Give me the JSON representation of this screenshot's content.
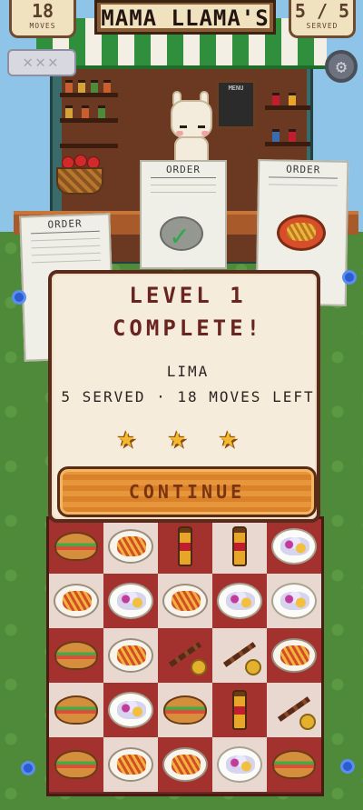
{
  "hud": {
    "moves_value": "18",
    "moves_label": "MOVES",
    "title": "MAMA LLAMA'S",
    "served_value": "5 / 5",
    "served_label": "SERVED",
    "strikes": "✕✕✕",
    "settings_icon": "gear-icon"
  },
  "stall": {
    "menu_board_label": "MENU",
    "orders": [
      {
        "label": "ORDER",
        "item": "sandwich-icon",
        "status": ""
      },
      {
        "label": "ORDER",
        "item": "burger-icon",
        "status": "completed"
      },
      {
        "label": "ORDER",
        "item": "fries-icon",
        "status": ""
      }
    ]
  },
  "modal": {
    "title_line1": "LEVEL 1",
    "title_line2": "COMPLETE!",
    "city": "LIMA",
    "stats": "5 SERVED · 18 MOVES LEFT",
    "stars_earned": 3,
    "stars_total": 3,
    "continue_label": "CONTINUE"
  },
  "board": {
    "rows": 5,
    "cols": 5,
    "tiles": [
      [
        "burger",
        "fries",
        "soda",
        "soda",
        "ceviche"
      ],
      [
        "fries",
        "ceviche",
        "fries",
        "ceviche",
        "ceviche"
      ],
      [
        "burger",
        "fries",
        "skewer",
        "skewer",
        "fries"
      ],
      [
        "burger",
        "ceviche",
        "burger",
        "soda",
        "skewer"
      ],
      [
        "burger",
        "fries",
        "fries",
        "ceviche",
        "burger"
      ]
    ]
  },
  "colors": {
    "accent_red": "#6a2420",
    "button_orange": "#e8963b",
    "board_red": "#a3322e",
    "board_cream": "#e9d8cf",
    "star_gold": "#f4b92a"
  }
}
